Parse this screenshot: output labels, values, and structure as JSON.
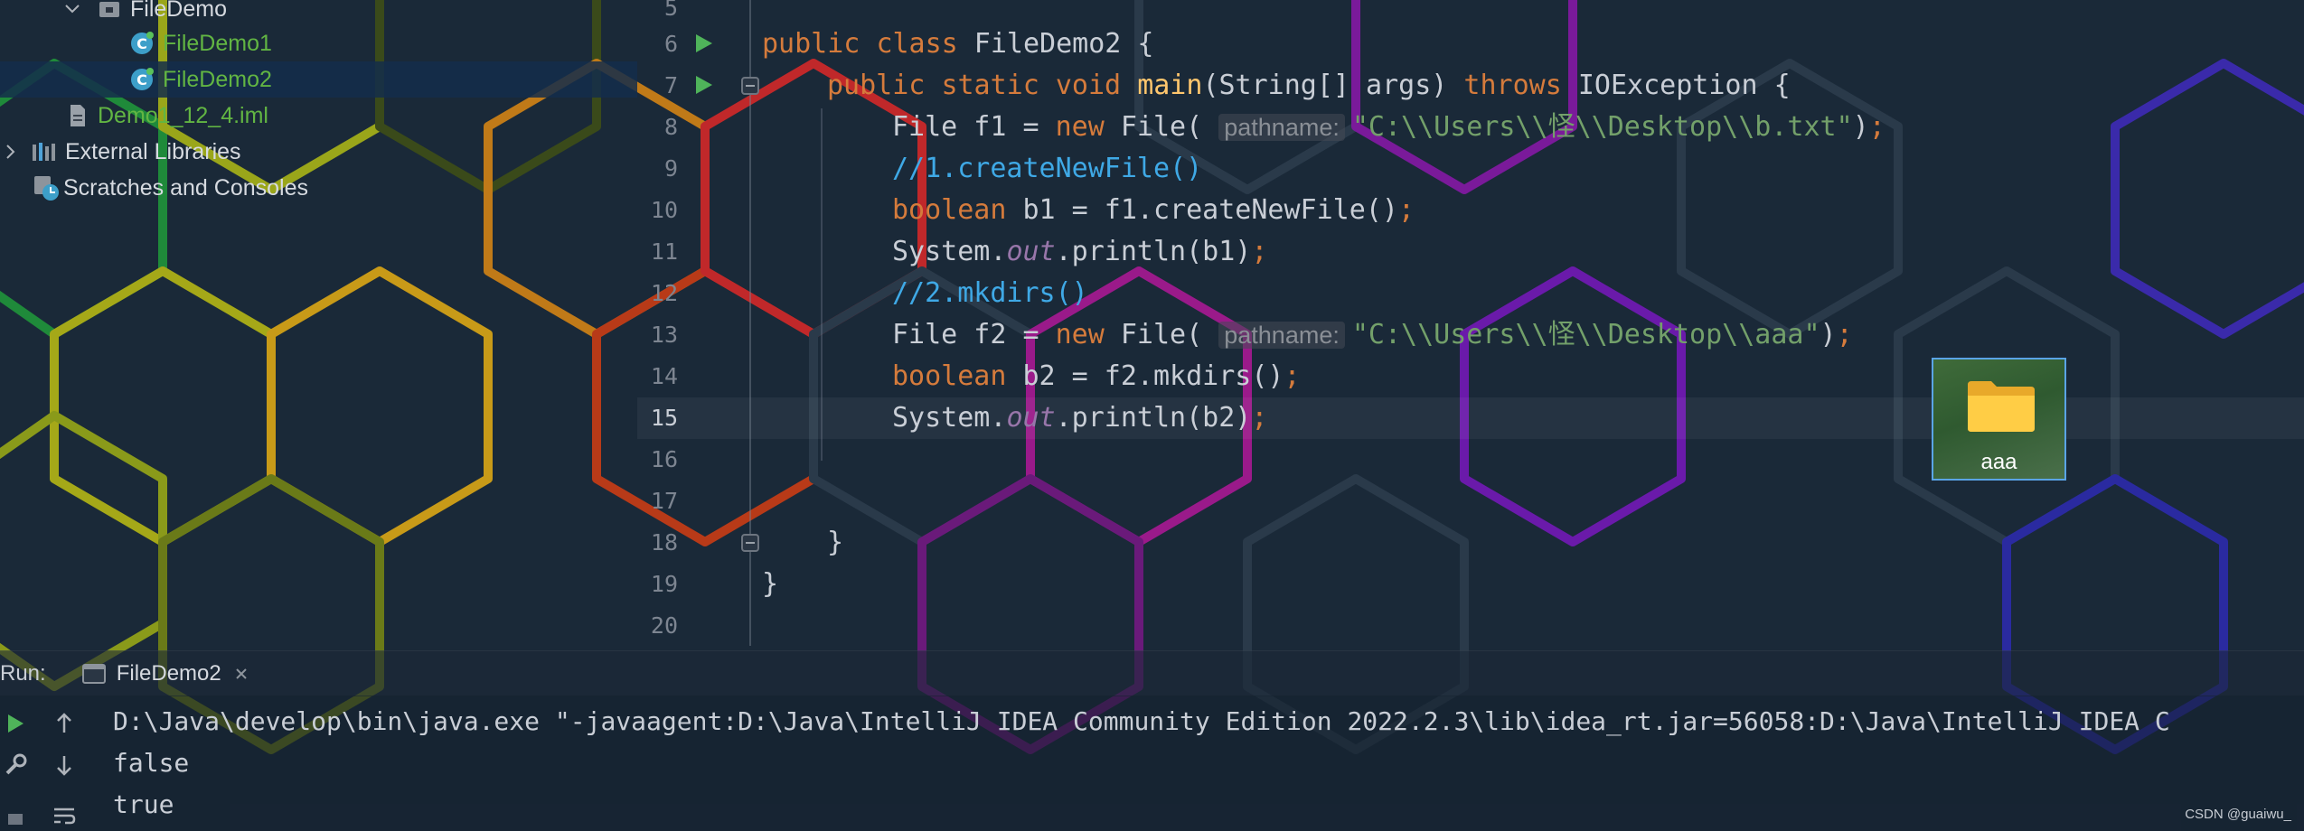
{
  "project_tree": {
    "items": [
      {
        "label": "FileDemo",
        "icon": "package-icon"
      },
      {
        "label": "FileDemo1",
        "icon": "java-class-icon"
      },
      {
        "label": "FileDemo2",
        "icon": "java-class-icon"
      },
      {
        "label": "Demo1_12_4.iml",
        "icon": "iml-file-icon"
      },
      {
        "label": "External Libraries",
        "icon": "library-icon"
      },
      {
        "label": "Scratches and Consoles",
        "icon": "scratches-icon"
      }
    ]
  },
  "editor": {
    "line_numbers": [
      "5",
      "6",
      "7",
      "8",
      "9",
      "10",
      "11",
      "12",
      "13",
      "14",
      "15",
      "16",
      "17",
      "18",
      "19",
      "20"
    ],
    "code": {
      "l6": {
        "kw1": "public",
        "kw2": "class",
        "rest": " FileDemo2 {"
      },
      "l7": {
        "kw1": "public",
        "kw2": "static",
        "kw3": "void",
        "fn": "main",
        "mid": "(String[] args) ",
        "kw4": "throws",
        "rest": " IOException {"
      },
      "l8": {
        "pre": "File f1 = ",
        "kw": "new",
        "mid": " File( ",
        "hint": "pathname:",
        "str": "\"C:\\\\Users\\\\怪\\\\Desktop\\\\b.txt\"",
        "end": ")",
        "semi": ";"
      },
      "l9": {
        "comment": "//1.createNewFile()"
      },
      "l10": {
        "kw": "boolean",
        "rest": " b1 = f1.createNewFile()",
        "semi": ";"
      },
      "l11": {
        "pre": "System.",
        "static": "out",
        "rest": ".println(b1)",
        "semi": ";"
      },
      "l12": {
        "comment": "//2.mkdirs()"
      },
      "l13": {
        "pre": "File f2 = ",
        "kw": "new",
        "mid": " File( ",
        "hint": "pathname:",
        "str": "\"C:\\\\Users\\\\怪\\\\Desktop\\\\aaa\"",
        "end": ")",
        "semi": ";"
      },
      "l14": {
        "kw": "boolean",
        "rest": " b2 = f2.mkdirs()",
        "semi": ";"
      },
      "l15": {
        "pre": "System.",
        "static": "out",
        "rest": ".println(b2)",
        "semi": ";"
      },
      "l18": {
        "text": "}"
      },
      "l19": {
        "text": "}"
      }
    }
  },
  "run_panel": {
    "label": "Run:",
    "tab_label": "FileDemo2",
    "console_lines": [
      "D:\\Java\\develop\\bin\\java.exe \"-javaagent:D:\\Java\\IntelliJ IDEA Community Edition 2022.2.3\\lib\\idea_rt.jar=56058:D:\\Java\\IntelliJ IDEA C",
      "false",
      "true"
    ]
  },
  "desktop": {
    "folder_label": "aaa"
  },
  "watermark": "CSDN @guaiwu_",
  "colors": {
    "keyword": "#d57b3c",
    "function": "#ffc66d",
    "string": "#73a06a",
    "comment": "#3fa9e6",
    "static_field": "#9876aa"
  }
}
